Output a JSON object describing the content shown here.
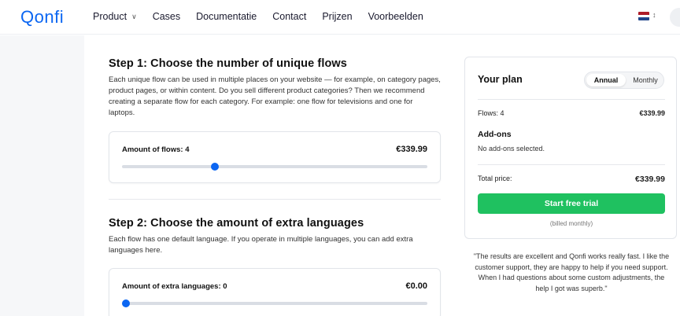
{
  "header": {
    "logo": "Qonfi",
    "nav": [
      {
        "label": "Product",
        "has_dropdown": true
      },
      {
        "label": "Cases"
      },
      {
        "label": "Documentatie"
      },
      {
        "label": "Contact"
      },
      {
        "label": "Prijzen"
      },
      {
        "label": "Voorbeelden"
      }
    ],
    "flag_icon": "netherlands-flag-icon",
    "flag_colors": [
      "#ae1c28",
      "#ffffff",
      "#21468b"
    ]
  },
  "step1": {
    "title": "Step 1: Choose the number of unique flows",
    "description": "Each unique flow can be used in multiple places on your website — for example, on category pages, product pages, or within content. Do you sell different product categories? Then we recommend creating a separate flow for each category. For example: one flow for televisions and one for laptops.",
    "slider_label": "Amount of flows: 4",
    "price": "€339.99",
    "slider_fraction": 0.3
  },
  "step2": {
    "title": "Step 2: Choose the amount of extra languages",
    "description": "Each flow has one default language. If you operate in multiple languages, you can add extra languages here.",
    "slider_label": "Amount of extra languages: 0",
    "price": "€0.00",
    "slider_fraction": 0.0
  },
  "plan": {
    "title": "Your plan",
    "toggle": {
      "annual": "Annual",
      "monthly": "Monthly",
      "selected": "Annual"
    },
    "flows_label": "Flows: 4",
    "flows_value": "€339.99",
    "addons_title": "Add-ons",
    "addons_empty": "No add-ons selected.",
    "total_label": "Total price:",
    "total_value": "€339.99",
    "cta": "Start free trial",
    "billed": "(billed monthly)"
  },
  "testimonial": "\"The results are excellent and Qonfi works really fast. I like the customer support, they are happy to help if you need support. When I had questions about some custom adjustments, the help I got was superb.\"",
  "colors": {
    "brand_blue": "#0b66f2",
    "cta_green": "#1fc160"
  }
}
